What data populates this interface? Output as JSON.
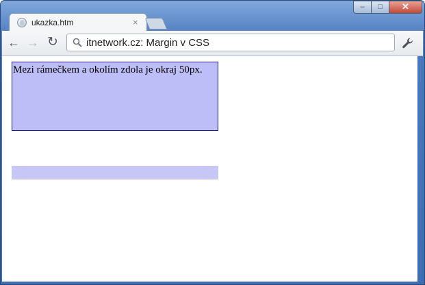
{
  "tab": {
    "title": "ukazka.htm",
    "close_glyph": "×",
    "favicon": "page-globe-icon"
  },
  "window_controls": {
    "minimize": "–",
    "maximize": "□",
    "close": "✕"
  },
  "toolbar": {
    "back_glyph": "←",
    "forward_glyph": "→",
    "reload_glyph": "↻",
    "address": "itnetwork.cz: Margin v CSS",
    "search_icon": "search-icon",
    "menu_icon": "wrench-icon"
  },
  "page": {
    "box_text": "Mezi rámečkem a okolím zdola je okraj 50px."
  },
  "colors": {
    "frame": "#4a78bd",
    "box_fill": "#bdbdf7",
    "box_border": "#1b1b8f",
    "second_box_fill": "#c7c7f5"
  }
}
